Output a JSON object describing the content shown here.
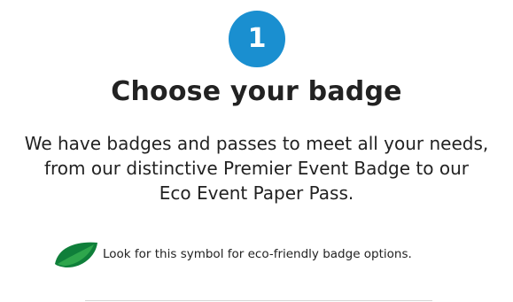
{
  "step": {
    "number": "1"
  },
  "heading": {
    "title": "Choose your badge"
  },
  "description": {
    "lines": [
      "We have badges and passes to meet all your needs,",
      "from our distinctive Premier Event Badge to our",
      "Eco Event Paper Pass."
    ]
  },
  "eco_note": {
    "icon": "leaf-icon",
    "text": "Look for this symbol for eco-friendly badge options."
  },
  "colors": {
    "accent": "#1a8fd0",
    "leaf_dark": "#0f7f3a",
    "leaf_light": "#2ea64c"
  }
}
